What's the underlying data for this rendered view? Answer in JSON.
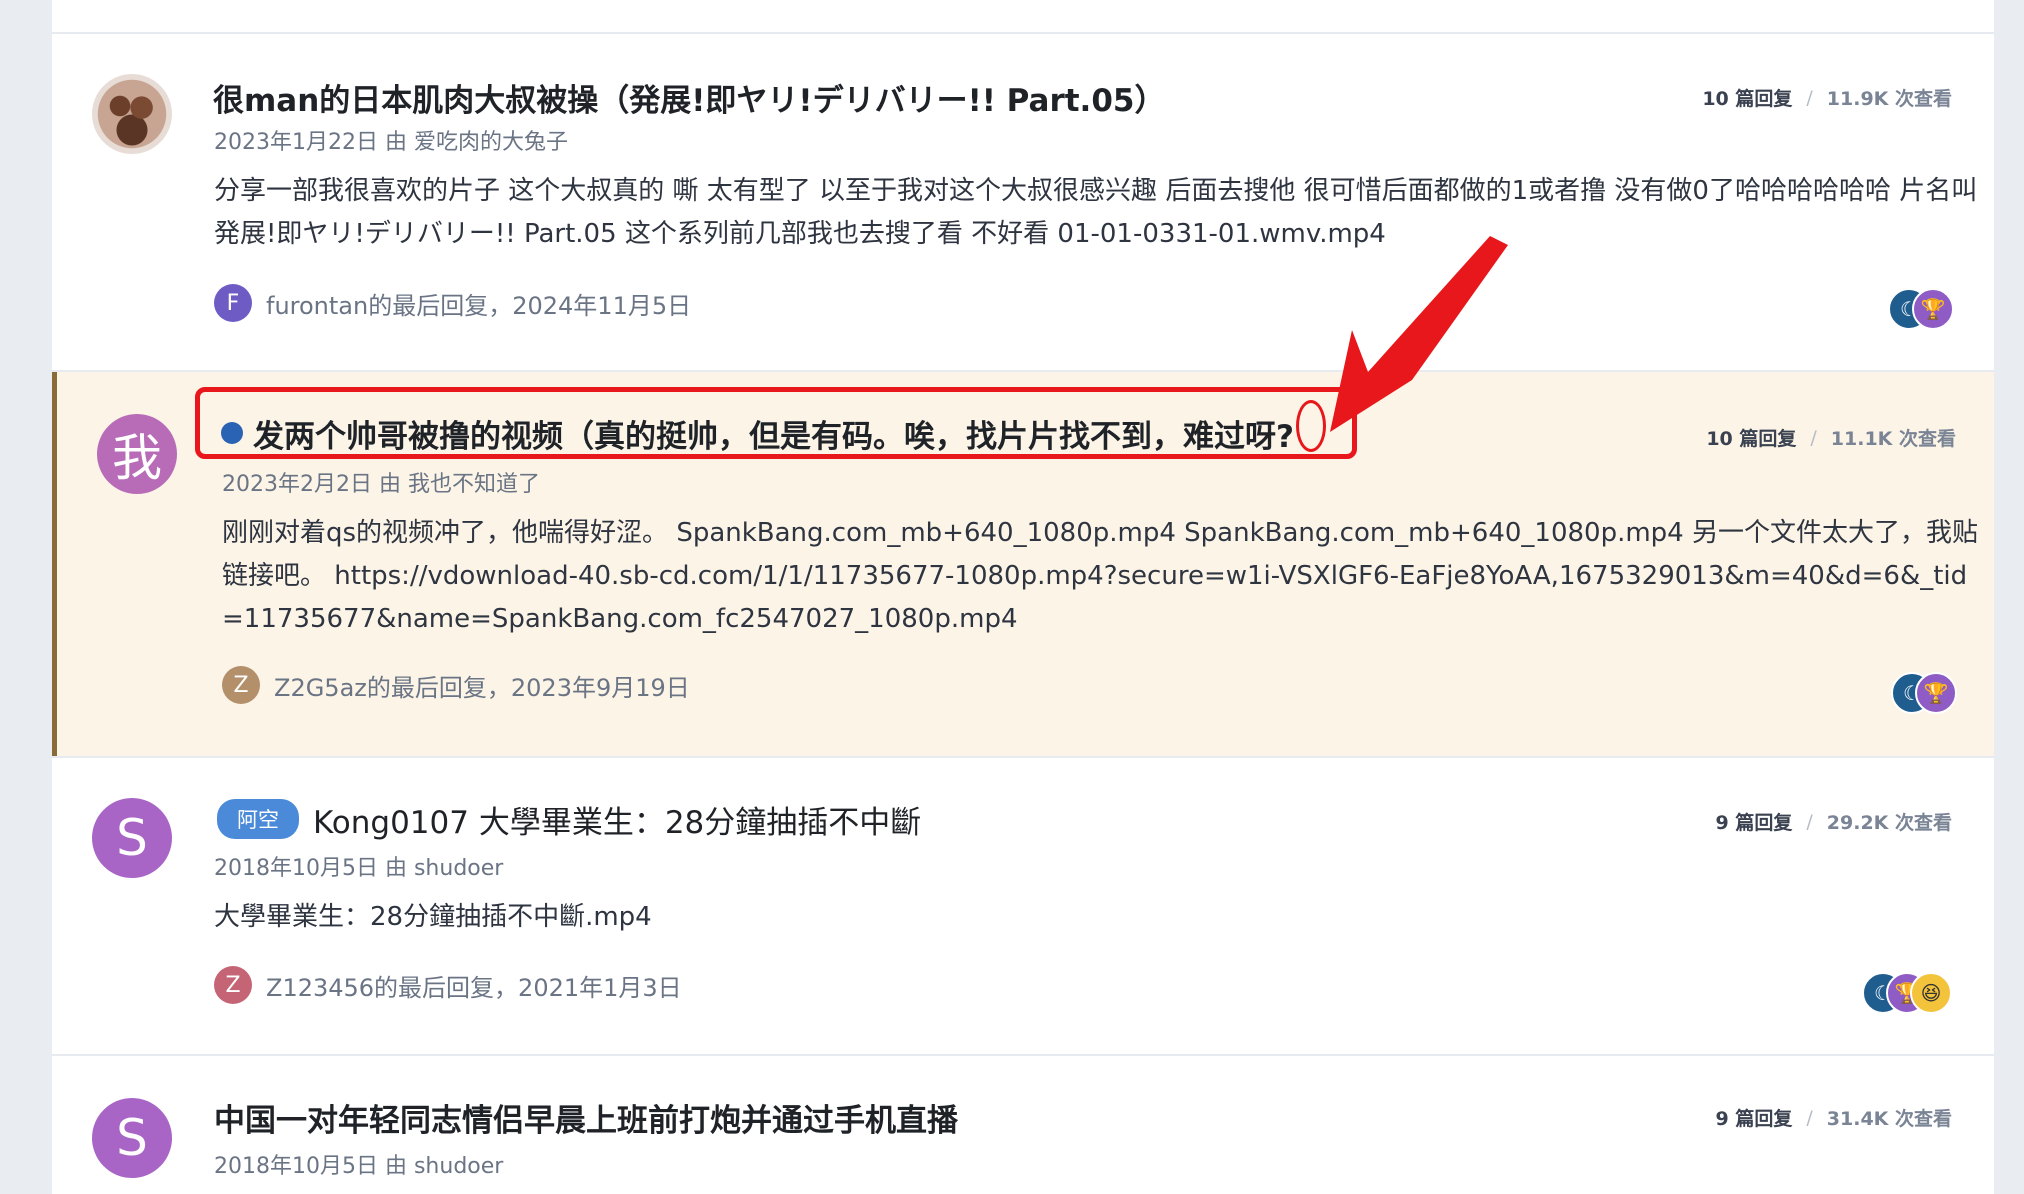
{
  "topics": [
    {
      "title": "很man的日本肌肉大叔被操（発展!即ヤリ!デリバリー!! Part.05）",
      "meta": "2023年1月22日 由 爱吃肉的大兔子",
      "excerpt": "分享一部我很喜欢的片子 这个大叔真的 嘶 太有型了 以至于我对这个大叔很感兴趣 后面去搜他 很可惜后面都做的1或者撸 没有做0了哈哈哈哈哈哈 片名叫 発展!即ヤリ!デリバリー!! Part.05 这个系列前几部我也去搜了看 不好看 01-01-0331-01.wmv.mp4",
      "last_avatar": "F",
      "last_reply": "furontan的最后回复，2024年11月5日",
      "replies": "10 篇回复",
      "views": "11.9K 次查看"
    },
    {
      "title": "发两个帅哥被撸的视频（真的挺帅，但是有码。唉，找片片找不到，难过呀?",
      "avatar": "我",
      "meta": "2023年2月2日 由 我也不知道了",
      "excerpt": "刚刚对着qs的视频冲了，他喘得好涩。 SpankBang.com_mb+640_1080p.mp4 SpankBang.com_mb+640_1080p.mp4 另一个文件太大了，我贴链接吧。 https://vdownload-40.sb-cd.com/1/1/11735677-1080p.mp4?secure=w1i-VSXlGF6-EaFje8YoAA,1675329013&m=40&d=6&_tid=11735677&name=SpankBang.com_fc2547027_1080p.mp4",
      "last_avatar": "Z",
      "last_reply": "Z2G5az的最后回复，2023年9月19日",
      "replies": "10 篇回复",
      "views": "11.1K 次查看"
    },
    {
      "tag": "阿空",
      "title": "Kong0107 大學畢業生：28分鐘抽插不中斷",
      "avatar": "S",
      "meta": "2018年10月5日 由 shudoer",
      "excerpt": "大學畢業生：28分鐘抽插不中斷.mp4",
      "last_avatar": "Z",
      "last_reply": "Z123456的最后回复，2021年1月3日",
      "replies": "9 篇回复",
      "views": "29.2K 次查看"
    },
    {
      "title": "中国一对年轻同志情侣早晨上班前打炮并通过手机直播",
      "avatar": "S",
      "meta": "2018年10月5日 由 shudoer",
      "replies": "9 篇回复",
      "views": "31.4K 次查看"
    }
  ],
  "colors": {
    "highlight_bg": "#fbf4e7",
    "annotation_red": "#e8171b",
    "avatar_purple": "#a865c6",
    "avatar_purple_alt": "#b86cb8",
    "tag_blue": "#4a8ad8",
    "unread_dot": "#2b63b4",
    "mini_avatar_f": "#6e5cc4",
    "mini_avatar_z1": "#b38f6a",
    "mini_avatar_z2": "#c46474"
  },
  "icons": {
    "badge_moon": "moon-badge-icon",
    "badge_trophy": "trophy-badge-icon",
    "badge_laugh": "laughing-emoji-icon",
    "annotation": "red-arrow-icon"
  }
}
